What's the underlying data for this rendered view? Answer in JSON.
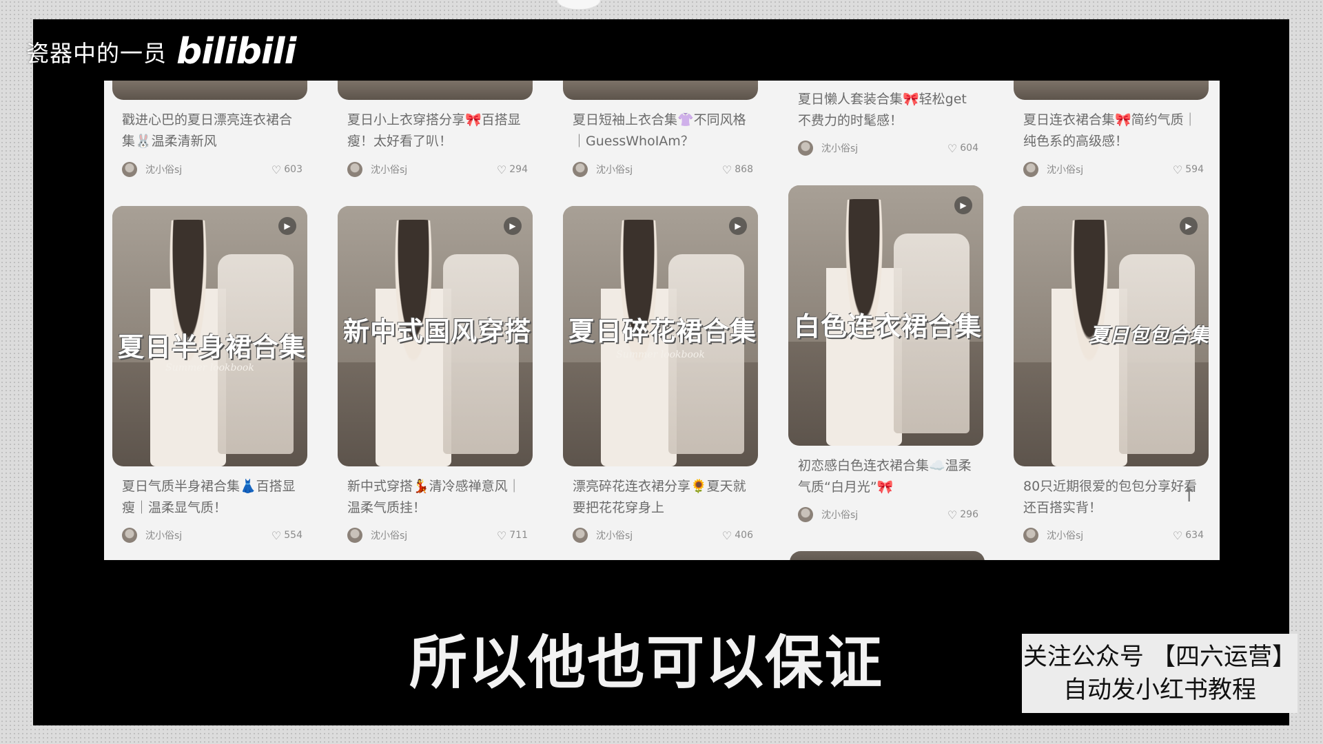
{
  "watermark": {
    "channel": "瓷器中的一员",
    "logo": "bilibili"
  },
  "feed": {
    "top_row": [
      {
        "title": "戳进心巴的夏日漂亮连衣裙合集🐰温柔清新风",
        "author": "沈小俗sj",
        "likes": "603"
      },
      {
        "title": "夏日小上衣穿搭分享🎀百搭显瘦！太好看了叭！",
        "author": "沈小俗sj",
        "likes": "294"
      },
      {
        "title": "夏日短袖上衣合集👚不同风格｜GuessWhoIAm？",
        "author": "沈小俗sj",
        "likes": "868"
      },
      {
        "title": "夏日懒人套装合集🎀轻松get不费力的时髦感！",
        "author": "沈小俗sj",
        "likes": "604"
      },
      {
        "title": "夏日连衣裙合集🎀简约气质｜纯色系的高级感！",
        "author": "沈小俗sj",
        "likes": "594"
      }
    ],
    "bottom_row": [
      {
        "overlay": "夏日半身裙合集",
        "overlay_sub": "Summer lookbook",
        "title": "夏日气质半身裙合集👗百搭显瘦｜温柔显气质！",
        "author": "沈小俗sj",
        "likes": "554"
      },
      {
        "overlay": "新中式国风穿搭",
        "overlay_sub": "",
        "title": "新中式穿搭💃清冷感禅意风｜温柔气质挂！",
        "author": "沈小俗sj",
        "likes": "711"
      },
      {
        "overlay": "夏日碎花裙合集",
        "overlay_sub": "Summer lookbook",
        "title": "漂亮碎花连衣裙分享🌻夏天就要把花花穿身上",
        "author": "沈小俗sj",
        "likes": "406"
      },
      {
        "overlay": "白色连衣裙合集",
        "overlay_sub": "",
        "title": "初恋感白色连衣裙合集☁️温柔气质“白月光”🎀",
        "author": "沈小俗sj",
        "likes": "296"
      },
      {
        "overlay": "夏日包包合集",
        "overlay_sub": "",
        "title": "80只近期很爱的包包分享好看还百搭实背！",
        "author": "沈小俗sj",
        "likes": "634"
      }
    ]
  },
  "icons": {
    "heart": "heart-icon",
    "play": "play-icon",
    "back_to_top": "arrow-up-icon"
  },
  "subtitle": "所以他也可以保证",
  "promo": {
    "line1": "关注公众号 【四六运营】",
    "line2": "自动发小红书教程"
  }
}
